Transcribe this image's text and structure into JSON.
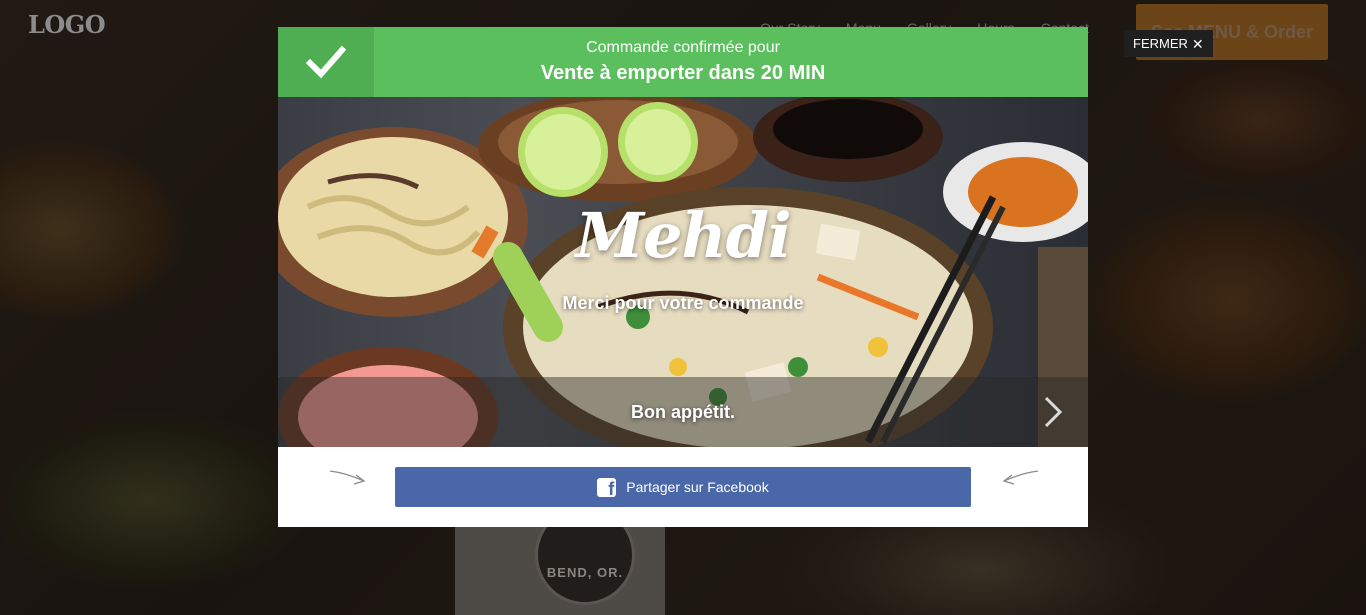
{
  "background": {
    "logo": "LOGO",
    "nav": [
      "Our Story",
      "Menu",
      "Gallery",
      "Hours",
      "Contact"
    ],
    "cta_label": "See MENU & Order",
    "badge_text": "BEND, OR."
  },
  "close": {
    "label": "FERMER"
  },
  "header": {
    "line1": "Commande confirmée pour",
    "line2": "Vente à emporter dans 20 MIN",
    "accent_color": "#5bbf5e"
  },
  "hero": {
    "name": "Mehdi",
    "thanks": "Merci pour votre commande",
    "appetit": "Bon appétit."
  },
  "share": {
    "facebook_label": "Partager sur Facebook",
    "facebook_color": "#4a67a8"
  },
  "icons": {
    "check": "check-icon",
    "close": "close-icon",
    "next": "chevron-right-icon",
    "facebook": "facebook-icon"
  }
}
